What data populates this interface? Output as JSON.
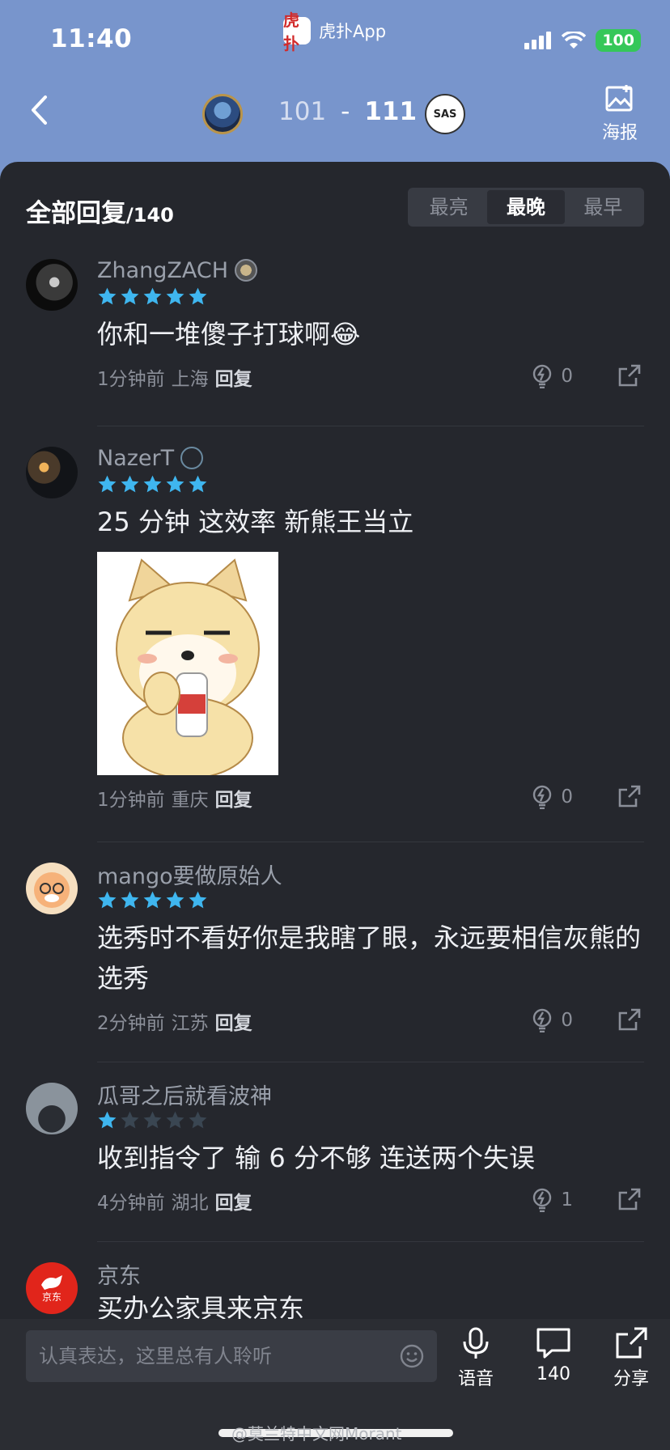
{
  "status_bar": {
    "time": "11:40",
    "app_name": "虎扑App",
    "app_logo_text": "虎扑",
    "battery": "100"
  },
  "header": {
    "score_home": "101",
    "score_sep": "-",
    "score_away": "111",
    "away_team_abbr": "SAS",
    "poster_label": "海报"
  },
  "replies": {
    "title": "全部回复",
    "count": "/140",
    "sort_tabs": [
      {
        "label": "最亮",
        "active": false
      },
      {
        "label": "最晚",
        "active": true
      },
      {
        "label": "最早",
        "active": false
      }
    ]
  },
  "comments": [
    {
      "username": "ZhangZACH",
      "rating": 5,
      "text": "你和一堆傻子打球啊😂",
      "time": "1分钟前",
      "location": "上海",
      "reply_label": "回复",
      "lights": "0"
    },
    {
      "username": "NazerT",
      "rating": 5,
      "text": "25 分钟 这效率 新熊王当立",
      "time": "1分钟前",
      "location": "重庆",
      "reply_label": "回复",
      "lights": "0"
    },
    {
      "username": "mango要做原始人",
      "rating": 5,
      "text": "选秀时不看好你是我瞎了眼，永远要相信灰熊的选秀",
      "time": "2分钟前",
      "location": "江苏",
      "reply_label": "回复",
      "lights": "0"
    },
    {
      "username": "瓜哥之后就看波神",
      "rating": 1,
      "text": "收到指令了 输 6 分不够 连送两个失误",
      "time": "4分钟前",
      "location": "湖北",
      "reply_label": "回复",
      "lights": "1"
    },
    {
      "username": "京东",
      "avatar_text": "京东",
      "text": "买办公家具来京东"
    }
  ],
  "bottom_bar": {
    "input_placeholder": "认真表达，这里总有人聆听",
    "voice_label": "语音",
    "comment_count": "140",
    "share_label": "分享"
  },
  "watermark": "@莫兰特中文网Morant",
  "colors": {
    "star_on": "#3fb6ef",
    "star_off": "#3a4652",
    "panel_bg": "#25272d",
    "header_bg": "#7895cc"
  }
}
